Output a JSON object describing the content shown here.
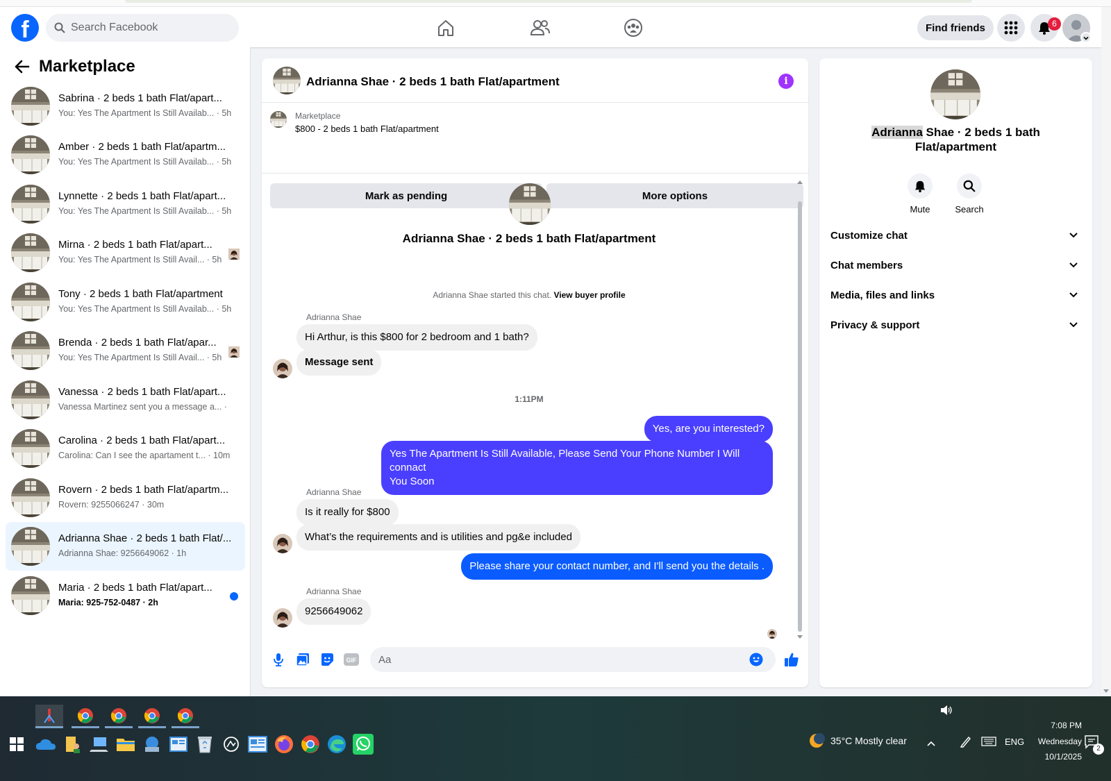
{
  "header": {
    "logo": "f",
    "search_placeholder": "Search Facebook",
    "find_friends": "Find friends",
    "notifications_count": "6"
  },
  "sidebar": {
    "title": "Marketplace",
    "conversations": [
      {
        "name": "Sabrina · 2 beds 1 bath Flat/apart...",
        "snippet": "You: Yes The Apartment Is Still Availab... · 5h"
      },
      {
        "name": "Amber · 2 beds 1 bath Flat/apartm...",
        "snippet": "You: Yes The Apartment Is Still Availab... · 5h"
      },
      {
        "name": "Lynnette · 2 beds 1 bath Flat/apart...",
        "snippet": "You: Yes The Apartment Is Still Availab... · 5h"
      },
      {
        "name": "Mirna · 2 beds 1 bath Flat/apart...",
        "snippet": "You: Yes The Apartment Is Still Avail... · 5h"
      },
      {
        "name": "Tony · 2 beds 1 bath Flat/apartment",
        "snippet": "You: Yes The Apartment Is Still Availab... · 5h"
      },
      {
        "name": "Brenda · 2 beds 1 bath Flat/apar...",
        "snippet": "You: Yes The Apartment Is Still Avail... · 5h"
      },
      {
        "name": "Vanessa · 2 beds 1 bath Flat/apart...",
        "snippet": "Vanessa Martinez sent you a message a... ·"
      },
      {
        "name": "Carolina · 2 beds 1 bath Flat/apart...",
        "snippet": "Carolina: Can I see the apartament t... · 10m"
      },
      {
        "name": "Rovern · 2 beds 1 bath Flat/apartm...",
        "snippet": "Rovern: 9255066247 · 30m"
      },
      {
        "name": "Adrianna Shae · 2 beds 1 bath Flat/...",
        "snippet": "Adrianna Shae: 9256649062 · 1h"
      },
      {
        "name": "Maria · 2 beds 1 bath Flat/apart...",
        "snippet": "Maria: 925-752-0487 · 2h"
      }
    ]
  },
  "chat": {
    "title": "Adrianna Shae · 2 beds 1 bath Flat/apartment",
    "listing_label": "Marketplace",
    "listing_title": "$800 - 2 beds 1 bath Flat/apartment",
    "mark_pending": "Mark as pending",
    "more_options": "More options",
    "intro_name": "Adrianna Shae · 2 beds 1 bath Flat/apartment",
    "started_text": "Adrianna Shae started this chat.",
    "view_buyer": "View buyer profile",
    "sender": "Adrianna Shae",
    "messages": {
      "m1": "Hi Arthur, is this $800 for 2 bedroom and 1 bath?",
      "m2": "Message sent",
      "time": "1:11PM",
      "m3": "Yes, are you interested?",
      "m4a": "Yes The Apartment Is Still Available, Please Send Your Phone Number I Will connact",
      "m4b": "You Soon",
      "m5": "Is it really for $800",
      "m6": "What’s the requirements and is utilities and pg&e included",
      "m7": "Please share your contact number, and I'll send you the details .",
      "m8": "9256649062"
    },
    "composer_placeholder": "Aa"
  },
  "info": {
    "name_highlight": "Adrianna",
    "name_rest": " Shae · 2 beds 1 bath",
    "name_line2": "Flat/apartment",
    "mute": "Mute",
    "search": "Search",
    "rows": [
      "Customize chat",
      "Chat members",
      "Media, files and links",
      "Privacy & support"
    ]
  },
  "taskbar": {
    "weather": "35°C  Mostly clear",
    "lang": "ENG",
    "time": "7:08 PM",
    "day": "Wednesday",
    "date": "10/1/2025",
    "notif_count": "2"
  },
  "colors": {
    "fb_blue": "#0866ff",
    "bubble_purple": "#4a3fff",
    "bubble_blue": "#0a5cff",
    "active_row": "#ebf5ff",
    "badge_red": "#e41e3f"
  }
}
